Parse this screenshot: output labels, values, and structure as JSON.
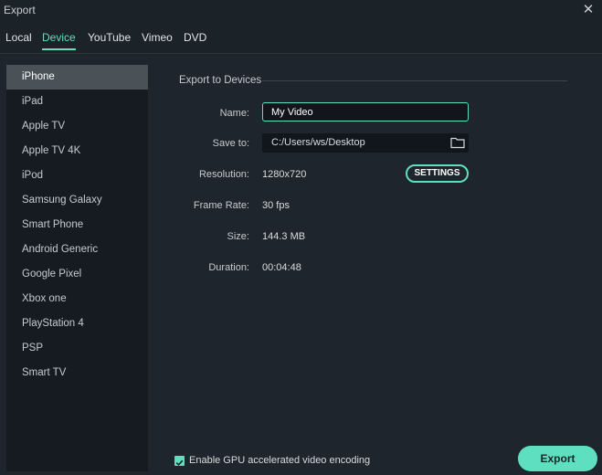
{
  "window": {
    "title": "Export"
  },
  "tabs": [
    {
      "label": "Local"
    },
    {
      "label": "Device"
    },
    {
      "label": "YouTube"
    },
    {
      "label": "Vimeo"
    },
    {
      "label": "DVD"
    }
  ],
  "active_tab": "Device",
  "sidebar": {
    "items": [
      {
        "label": "iPhone"
      },
      {
        "label": "iPad"
      },
      {
        "label": "Apple TV"
      },
      {
        "label": "Apple TV 4K"
      },
      {
        "label": "iPod"
      },
      {
        "label": "Samsung Galaxy"
      },
      {
        "label": "Smart Phone"
      },
      {
        "label": "Android Generic"
      },
      {
        "label": "Google Pixel"
      },
      {
        "label": "Xbox one"
      },
      {
        "label": "PlayStation 4"
      },
      {
        "label": "PSP"
      },
      {
        "label": "Smart TV"
      }
    ],
    "selected": "iPhone"
  },
  "main": {
    "section_title": "Export to Devices",
    "name": {
      "label": "Name:",
      "value": "My Video"
    },
    "save_to": {
      "label": "Save to:",
      "value": "C:/Users/ws/Desktop"
    },
    "resolution": {
      "label": "Resolution:",
      "value": "1280x720",
      "settings_label": "SETTINGS"
    },
    "frame_rate": {
      "label": "Frame Rate:",
      "value": "30 fps"
    },
    "size": {
      "label": "Size:",
      "value": "144.3 MB"
    },
    "duration": {
      "label": "Duration:",
      "value": "00:04:48"
    }
  },
  "footer": {
    "gpu_label": "Enable GPU accelerated video encoding",
    "gpu_checked": true,
    "export_label": "Export"
  },
  "colors": {
    "accent": "#5ee0c0",
    "background": "#1e252c",
    "sidebar": "#151b21",
    "selected": "#4a5258"
  },
  "icons": {
    "close": "close-icon",
    "folder": "folder-icon",
    "checkbox": "checkmark-icon"
  }
}
